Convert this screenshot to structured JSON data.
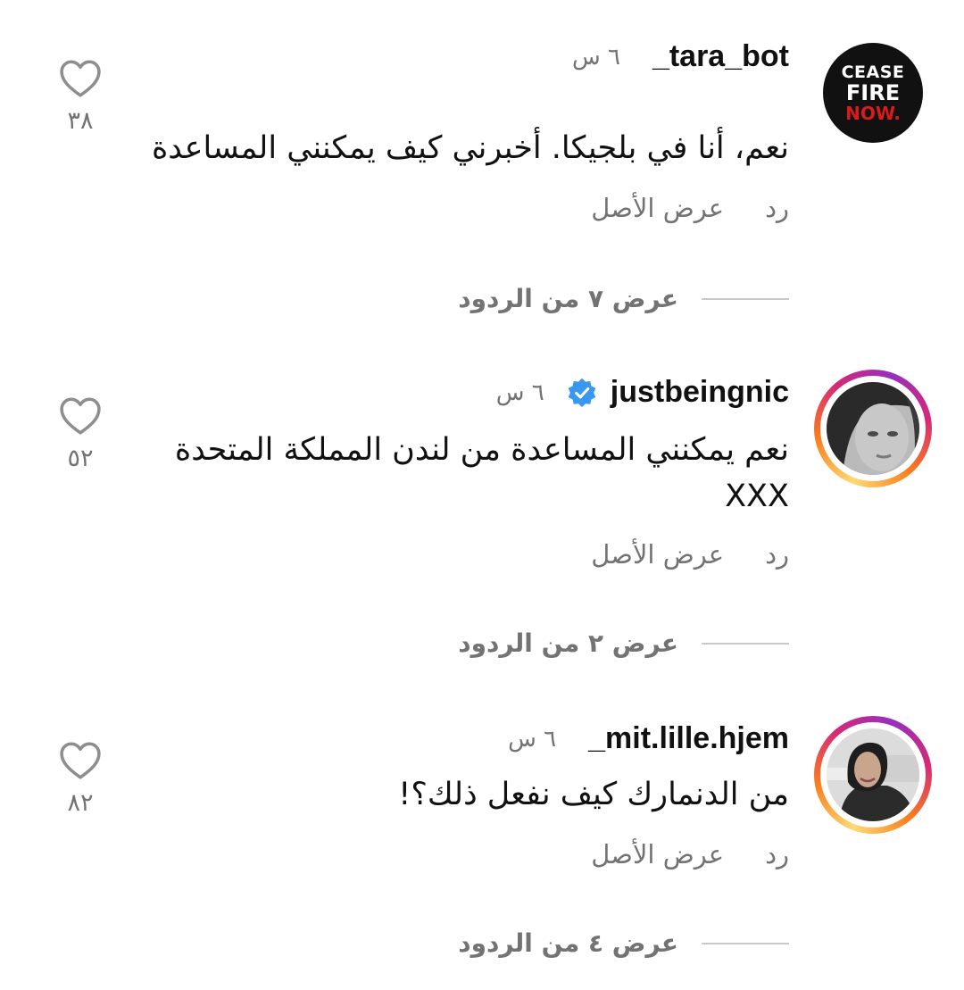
{
  "comments": [
    {
      "username": "_tara_bot",
      "time": "٦ س",
      "avatar_text": [
        "CEASE",
        "FIRE",
        "NOW."
      ],
      "verified": false,
      "text_lines": [
        "نعم، أنا في بلجيكا. أخبرني كيف يمكنني المساعدة"
      ],
      "reply_label": "رد",
      "see_original_label": "عرض الأصل",
      "view_replies_label": "عرض ٧ من الردود",
      "likes": "٣٨"
    },
    {
      "username": "justbeingnic",
      "time": "٦ س",
      "verified": true,
      "text_lines": [
        "نعم يمكنني المساعدة من لندن المملكة المتحدة",
        "XXX"
      ],
      "reply_label": "رد",
      "see_original_label": "عرض الأصل",
      "view_replies_label": "عرض ٢ من الردود",
      "likes": "٥٢"
    },
    {
      "username": "_mit.lille.hjem",
      "time": "٦ س",
      "verified": false,
      "text_lines": [
        "من الدنمارك كيف نفعل ذلك؟!"
      ],
      "reply_label": "رد",
      "see_original_label": "عرض الأصل",
      "view_replies_label": "عرض ٤ من الردود",
      "likes": "٨٢"
    }
  ],
  "colors": {
    "text": "#111111",
    "secondary": "#737373",
    "verified_blue": "#3897f0",
    "story_ring": [
      "#feda75",
      "#fa7e1e",
      "#d62976",
      "#962fbf"
    ]
  },
  "icons": {
    "like": "heart-outline-icon",
    "verified": "verified-badge-icon"
  }
}
